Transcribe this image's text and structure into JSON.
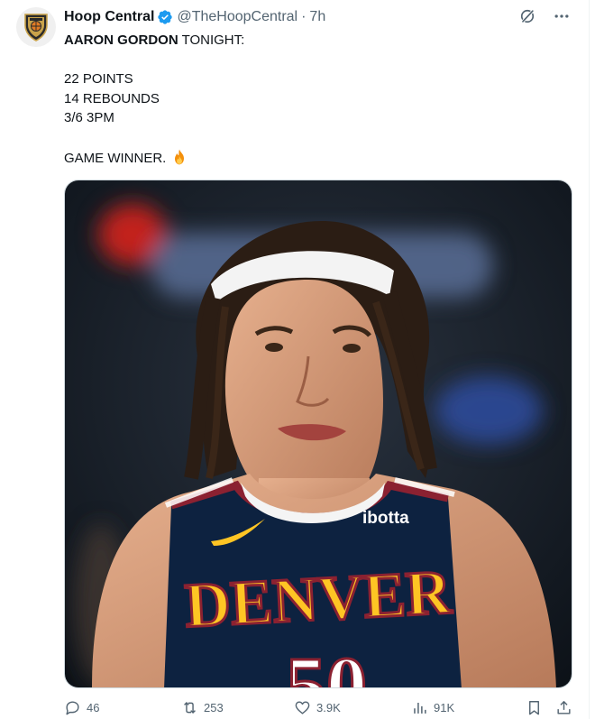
{
  "tweet": {
    "author_name": "Hoop Central",
    "handle": "@TheHoopCentral",
    "separator": "·",
    "time": "7h",
    "lines": {
      "title_bold": "AARON GORDON",
      "title_rest": " TONIGHT:",
      "stat1": "22 POINTS",
      "stat2": "14 REBOUNDS",
      "stat3": "3/6 3PM",
      "closing": "GAME WINNER. "
    },
    "emoji": "fire-emoji",
    "media": {
      "jersey_sponsor": "ibotta",
      "jersey_team": "DENVER",
      "jersey_number": "50"
    }
  },
  "actions": {
    "replies": "46",
    "retweets": "253",
    "likes": "3.9K",
    "views": "91K"
  },
  "icons": {
    "verified": "verified-badge-icon",
    "grok": "grok-icon",
    "more": "more-icon",
    "reply": "reply-icon",
    "retweet": "retweet-icon",
    "like": "heart-icon",
    "views": "views-icon",
    "bookmark": "bookmark-icon",
    "share": "share-icon"
  },
  "colors": {
    "verified_blue": "#1d9bf0",
    "secondary_text": "#536471",
    "jersey_navy": "#0d2240",
    "jersey_gold": "#fec524",
    "jersey_red": "#8b2131"
  }
}
